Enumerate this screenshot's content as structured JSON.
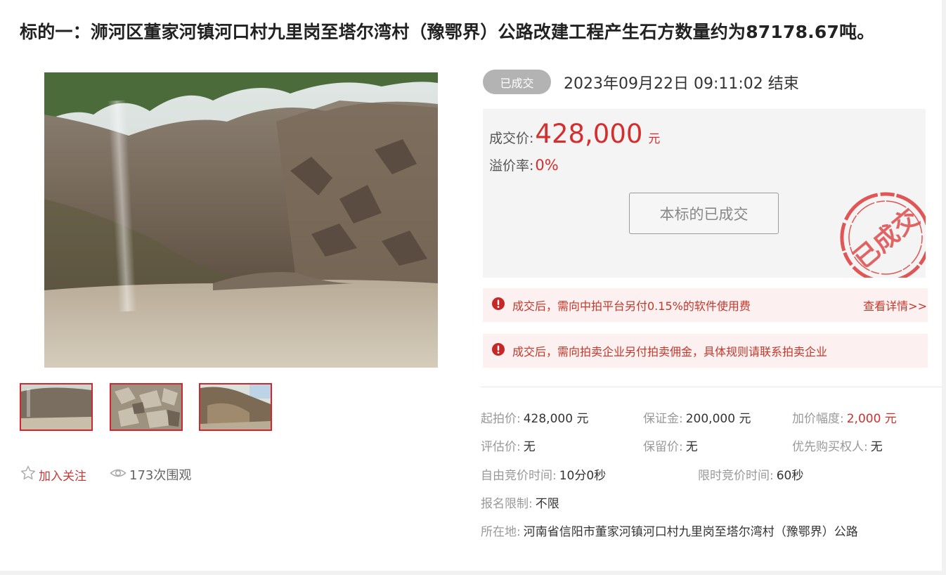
{
  "title": "标的一：浉河区董家河镇河口村九里岗至塔尔湾村（豫鄂界）公路改建工程产生石方数量约为87178.67吨。",
  "status": {
    "badge": "已成交",
    "end_time": "2023年09月22日  09:11:02 结束"
  },
  "price": {
    "label": "成交价:",
    "value": "428,000",
    "unit": "元",
    "premium_label": "溢价率:",
    "premium_value": "0%",
    "button": "本标的已成交",
    "stamp_text": "已成交"
  },
  "notices": [
    {
      "text": "成交后，需向中拍平台另付0.15%的软件使用费",
      "link": "查看详情>>"
    },
    {
      "text": "成交后，需向拍卖企业另付拍卖佣金，具体规则请联系拍卖企业"
    }
  ],
  "social": {
    "follow": "加入关注",
    "views": "173次围观"
  },
  "details": {
    "starting_price": {
      "label": "起拍价:",
      "value": "428,000 元"
    },
    "deposit": {
      "label": "保证金:",
      "value": "200,000 元"
    },
    "increment": {
      "label": "加价幅度:",
      "value": "2,000 元"
    },
    "appraisal": {
      "label": "评估价:",
      "value": "无"
    },
    "reserve": {
      "label": "保留价:",
      "value": "无"
    },
    "preemption": {
      "label": "优先购买权人:",
      "value": "无"
    },
    "free_bid_time": {
      "label": "自由竞价时间:",
      "value": "10分0秒"
    },
    "limited_bid_time": {
      "label": "限时竞价时间:",
      "value": "60秒"
    },
    "registration": {
      "label": "报名限制:",
      "value": "不限"
    },
    "location": {
      "label": "所在地:",
      "value": "河南省信阳市董家河镇河口村九里岗至塔尔湾村（豫鄂界）公路"
    }
  },
  "colors": {
    "accent_red": "#d32f2f",
    "badge_gray": "#b3b3b3",
    "notice_bg": "#fdf0f0",
    "panel_bg": "#f4f4f4"
  },
  "icons": [
    "star-icon",
    "eye-icon",
    "alert-icon"
  ]
}
